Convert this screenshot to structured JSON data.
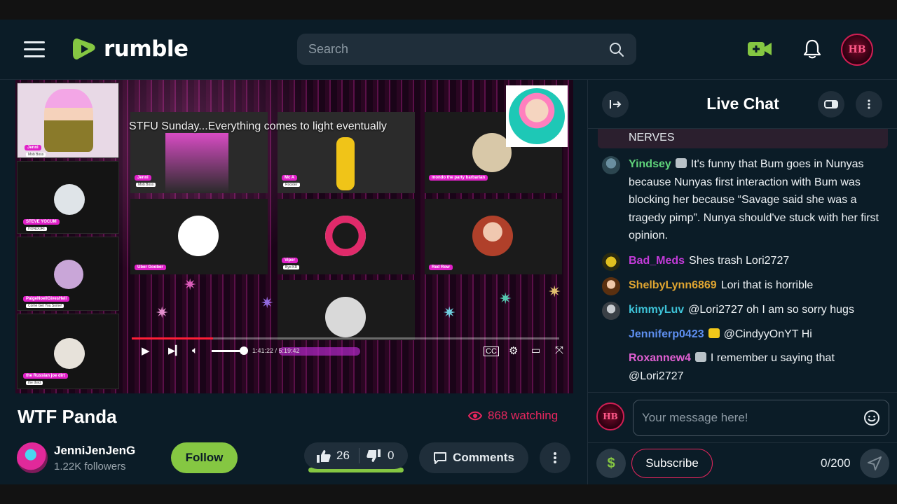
{
  "header": {
    "logo_text": "rumble",
    "search_placeholder": "Search",
    "avatar_text": "HB"
  },
  "video": {
    "stream_overlay_title": "STFU Sunday...Everything comes to light eventually",
    "time_display": "1:41:22 / 5:19:42",
    "progress": 0.19,
    "participants": [
      {
        "name": "Jenni",
        "sub": "Mob Boss"
      },
      {
        "name": "STEVE YOCUM",
        "sub": "HONDORI"
      },
      {
        "name": "PaigeNoellGivesHell",
        "sub": "Come Get You Some!"
      },
      {
        "name": "the Russian joe dirt",
        "sub": "the third"
      },
      {
        "name": "Jenni",
        "sub": "Mob Boss"
      },
      {
        "name": "Mc A",
        "sub": "Rooster"
      },
      {
        "name": "mondo the party barbarian",
        "sub": "plunder booty and grog"
      },
      {
        "name": "Uber Goober",
        "sub": ""
      },
      {
        "name": "Viper",
        "sub": "Bye-KR"
      },
      {
        "name": "Red Row",
        "sub": ""
      }
    ]
  },
  "info": {
    "title": "WTF Panda",
    "watching": "868 watching",
    "channel_name": "JenniJenJenG",
    "followers": "1.22K followers",
    "follow_label": "Follow",
    "likes": "26",
    "dislikes": "0",
    "comments_label": "Comments"
  },
  "chat": {
    "title": "Live Chat",
    "pinned_text": "NERVES",
    "messages": [
      {
        "user": "Yindsey",
        "color": "#5fd37a",
        "text": "It's funny that Bum goes in Nunyas because Nunyas first interaction with Bum was blocking her because “Savage said she was a tragedy pimp”. Nunya should've stuck with her first opinion."
      },
      {
        "user": "Bad_Meds",
        "color": "#c33bd9",
        "text": "Shes trash Lori2727"
      },
      {
        "user": "ShelbyLynn6869",
        "color": "#e0a531",
        "text": "Lori that is horrible"
      },
      {
        "user": "kimmyLuv",
        "color": "#3ec3d8",
        "text": "@Lori2727 oh I am so sorry hugs"
      },
      {
        "user": "Jenniferp0423",
        "color": "#5e8ff0",
        "text": "@CindyyOnYT Hi"
      },
      {
        "user": "Roxannew4",
        "color": "#e05fd2",
        "text": "I remember u saying that @Lori2727"
      }
    ],
    "input_placeholder": "Your message here!",
    "subscribe_label": "Subscribe",
    "char_count": "0/200",
    "dollar_label": "$",
    "avatar_text": "HB"
  },
  "colors": {
    "brand_green": "#85c742",
    "header_bg": "#0b1c27",
    "accent_red": "#e8265e"
  }
}
